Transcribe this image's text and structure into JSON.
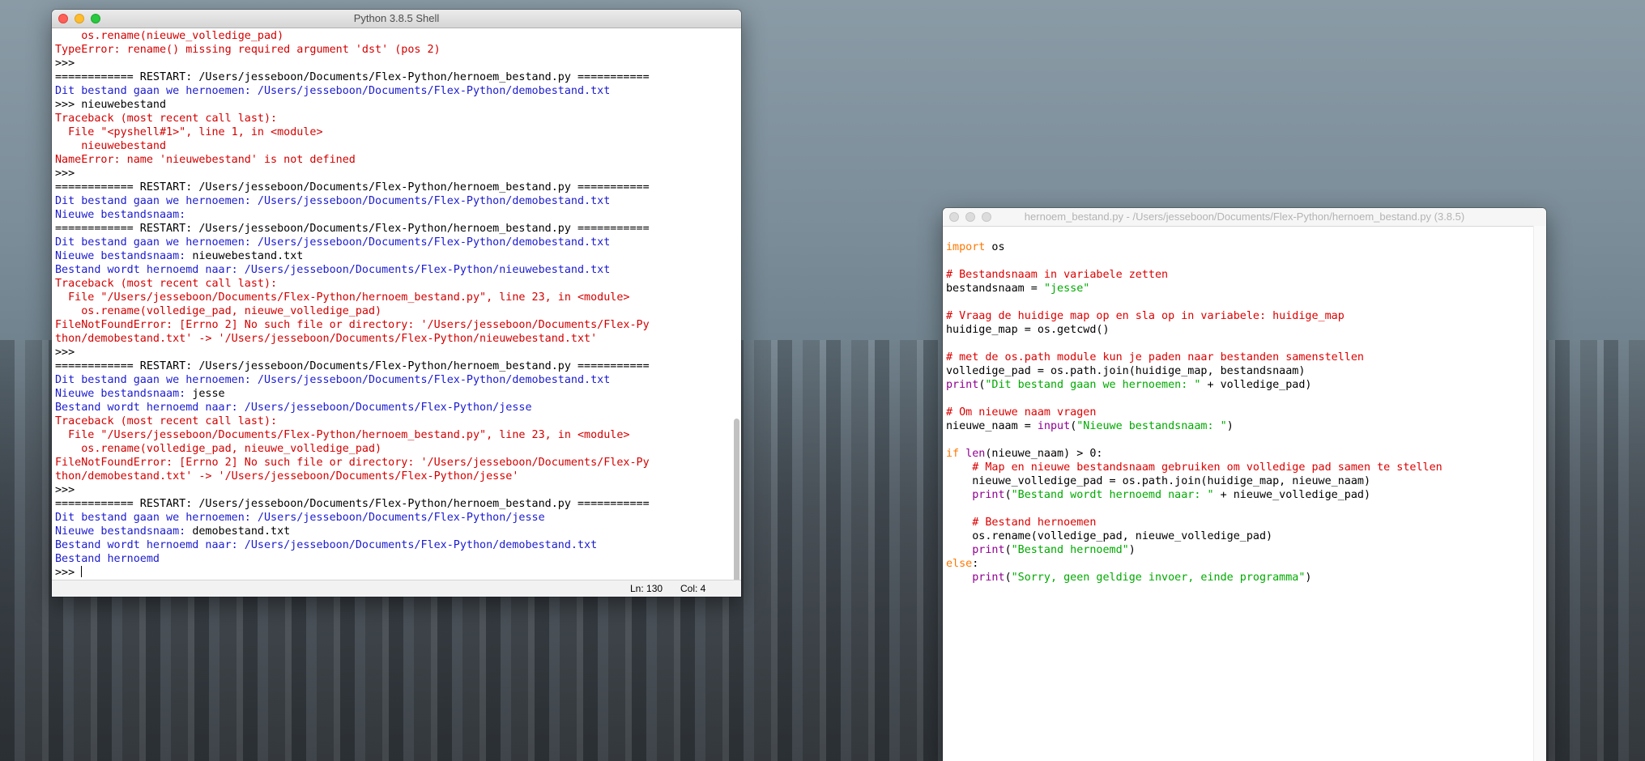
{
  "shell_window": {
    "title": "Python 3.8.5 Shell",
    "lines": [
      {
        "t": "    os.rename(nieuwe_volledige_pad)",
        "c": "err"
      },
      {
        "t": "TypeError: rename() missing required argument 'dst' (pos 2)",
        "c": "err"
      },
      {
        "t": ">>> ",
        "c": ""
      },
      {
        "t": "============ RESTART: /Users/jesseboon/Documents/Flex-Python/hernoem_bestand.py ===========",
        "c": ""
      },
      {
        "t": "Dit bestand gaan we hernoemen: /Users/jesseboon/Documents/Flex-Python/demobestand.txt",
        "c": "out"
      },
      {
        "t": ">>> nieuwebestand",
        "c": ""
      },
      {
        "t": "Traceback (most recent call last):",
        "c": "err"
      },
      {
        "t": "  File \"<pyshell#1>\", line 1, in <module>",
        "c": "err"
      },
      {
        "t": "    nieuwebestand",
        "c": "err"
      },
      {
        "t": "NameError: name 'nieuwebestand' is not defined",
        "c": "err"
      },
      {
        "t": ">>> ",
        "c": ""
      },
      {
        "t": "============ RESTART: /Users/jesseboon/Documents/Flex-Python/hernoem_bestand.py ===========",
        "c": ""
      },
      {
        "t": "Dit bestand gaan we hernoemen: /Users/jesseboon/Documents/Flex-Python/demobestand.txt",
        "c": "out"
      },
      {
        "t": "Nieuwe bestandsnaam: ",
        "c": "out"
      },
      {
        "t": "============ RESTART: /Users/jesseboon/Documents/Flex-Python/hernoem_bestand.py ===========",
        "c": ""
      },
      {
        "t": "Dit bestand gaan we hernoemen: /Users/jesseboon/Documents/Flex-Python/demobestand.txt",
        "c": "out"
      },
      {
        "segs": [
          {
            "t": "Nieuwe bestandsnaam: ",
            "c": "out"
          },
          {
            "t": "nieuwebestand.txt",
            "c": ""
          }
        ]
      },
      {
        "t": "Bestand wordt hernoemd naar: /Users/jesseboon/Documents/Flex-Python/nieuwebestand.txt",
        "c": "out"
      },
      {
        "t": "Traceback (most recent call last):",
        "c": "err"
      },
      {
        "t": "  File \"/Users/jesseboon/Documents/Flex-Python/hernoem_bestand.py\", line 23, in <module>",
        "c": "err"
      },
      {
        "t": "    os.rename(volledige_pad, nieuwe_volledige_pad)",
        "c": "err"
      },
      {
        "t": "FileNotFoundError: [Errno 2] No such file or directory: '/Users/jesseboon/Documents/Flex-Py",
        "c": "err"
      },
      {
        "t": "thon/demobestand.txt' -> '/Users/jesseboon/Documents/Flex-Python/nieuwebestand.txt'",
        "c": "err"
      },
      {
        "t": ">>> ",
        "c": ""
      },
      {
        "t": "============ RESTART: /Users/jesseboon/Documents/Flex-Python/hernoem_bestand.py ===========",
        "c": ""
      },
      {
        "t": "Dit bestand gaan we hernoemen: /Users/jesseboon/Documents/Flex-Python/demobestand.txt",
        "c": "out"
      },
      {
        "segs": [
          {
            "t": "Nieuwe bestandsnaam: ",
            "c": "out"
          },
          {
            "t": "jesse",
            "c": ""
          }
        ]
      },
      {
        "t": "Bestand wordt hernoemd naar: /Users/jesseboon/Documents/Flex-Python/jesse",
        "c": "out"
      },
      {
        "t": "Traceback (most recent call last):",
        "c": "err"
      },
      {
        "t": "  File \"/Users/jesseboon/Documents/Flex-Python/hernoem_bestand.py\", line 23, in <module>",
        "c": "err"
      },
      {
        "t": "    os.rename(volledige_pad, nieuwe_volledige_pad)",
        "c": "err"
      },
      {
        "t": "FileNotFoundError: [Errno 2] No such file or directory: '/Users/jesseboon/Documents/Flex-Py",
        "c": "err"
      },
      {
        "t": "thon/demobestand.txt' -> '/Users/jesseboon/Documents/Flex-Python/jesse'",
        "c": "err"
      },
      {
        "t": ">>> ",
        "c": ""
      },
      {
        "t": "============ RESTART: /Users/jesseboon/Documents/Flex-Python/hernoem_bestand.py ===========",
        "c": ""
      },
      {
        "t": "Dit bestand gaan we hernoemen: /Users/jesseboon/Documents/Flex-Python/jesse",
        "c": "out"
      },
      {
        "segs": [
          {
            "t": "Nieuwe bestandsnaam: ",
            "c": "out"
          },
          {
            "t": "demobestand.txt",
            "c": ""
          }
        ]
      },
      {
        "t": "Bestand wordt hernoemd naar: /Users/jesseboon/Documents/Flex-Python/demobestand.txt",
        "c": "out"
      },
      {
        "t": "Bestand hernoemd",
        "c": "out"
      },
      {
        "t": ">>> ",
        "c": "",
        "cursor": true
      }
    ],
    "status": {
      "line": "Ln: 130",
      "col": "Col: 4"
    }
  },
  "editor_window": {
    "title": "hernoem_bestand.py - /Users/jesseboon/Documents/Flex-Python/hernoem_bestand.py (3.8.5)",
    "lines": [
      {
        "segs": [
          {
            "t": "import",
            "c": "kw"
          },
          {
            "t": " os",
            "c": ""
          }
        ]
      },
      {
        "segs": []
      },
      {
        "segs": [
          {
            "t": "# Bestandsnaam in variabele zetten",
            "c": "cm"
          }
        ]
      },
      {
        "segs": [
          {
            "t": "bestandsnaam = ",
            "c": ""
          },
          {
            "t": "\"jesse\"",
            "c": "st"
          }
        ]
      },
      {
        "segs": []
      },
      {
        "segs": [
          {
            "t": "# Vraag de huidige map op en sla op in variabele: huidige_map",
            "c": "cm"
          }
        ]
      },
      {
        "segs": [
          {
            "t": "huidige_map = os.getcwd()",
            "c": ""
          }
        ]
      },
      {
        "segs": []
      },
      {
        "segs": [
          {
            "t": "# met de os.path module kun je paden naar bestanden samenstellen",
            "c": "cm"
          }
        ]
      },
      {
        "segs": [
          {
            "t": "volledige_pad = os.path.join(huidige_map, bestandsnaam)",
            "c": ""
          }
        ]
      },
      {
        "segs": [
          {
            "t": "print",
            "c": "bi"
          },
          {
            "t": "(",
            "c": ""
          },
          {
            "t": "\"Dit bestand gaan we hernoemen: \"",
            "c": "st"
          },
          {
            "t": " + volledige_pad)",
            "c": ""
          }
        ]
      },
      {
        "segs": []
      },
      {
        "segs": [
          {
            "t": "# Om nieuwe naam vragen",
            "c": "cm"
          }
        ]
      },
      {
        "segs": [
          {
            "t": "nieuwe_naam = ",
            "c": ""
          },
          {
            "t": "input",
            "c": "bi"
          },
          {
            "t": "(",
            "c": ""
          },
          {
            "t": "\"Nieuwe bestandsnaam: \"",
            "c": "st"
          },
          {
            "t": ")",
            "c": ""
          }
        ]
      },
      {
        "segs": []
      },
      {
        "segs": [
          {
            "t": "if",
            "c": "kw"
          },
          {
            "t": " ",
            "c": ""
          },
          {
            "t": "len",
            "c": "bi"
          },
          {
            "t": "(nieuwe_naam) > 0:",
            "c": ""
          }
        ]
      },
      {
        "segs": [
          {
            "t": "    ",
            "c": ""
          },
          {
            "t": "# Map en nieuwe bestandsnaam gebruiken om volledige pad samen te stellen",
            "c": "cm"
          }
        ]
      },
      {
        "segs": [
          {
            "t": "    nieuwe_volledige_pad = os.path.join(huidige_map, nieuwe_naam)",
            "c": ""
          }
        ]
      },
      {
        "segs": [
          {
            "t": "    ",
            "c": ""
          },
          {
            "t": "print",
            "c": "bi"
          },
          {
            "t": "(",
            "c": ""
          },
          {
            "t": "\"Bestand wordt hernoemd naar: \"",
            "c": "st"
          },
          {
            "t": " + nieuwe_volledige_pad)",
            "c": ""
          }
        ]
      },
      {
        "segs": []
      },
      {
        "segs": [
          {
            "t": "    ",
            "c": ""
          },
          {
            "t": "# Bestand hernoemen",
            "c": "cm"
          }
        ]
      },
      {
        "segs": [
          {
            "t": "    os.rename(volledige_pad, nieuwe_volledige_pad)",
            "c": ""
          }
        ]
      },
      {
        "segs": [
          {
            "t": "    ",
            "c": ""
          },
          {
            "t": "print",
            "c": "bi"
          },
          {
            "t": "(",
            "c": ""
          },
          {
            "t": "\"Bestand hernoemd\"",
            "c": "st"
          },
          {
            "t": ")",
            "c": ""
          }
        ]
      },
      {
        "segs": [
          {
            "t": "else",
            "c": "kw"
          },
          {
            "t": ":",
            "c": ""
          }
        ]
      },
      {
        "segs": [
          {
            "t": "    ",
            "c": ""
          },
          {
            "t": "print",
            "c": "bi"
          },
          {
            "t": "(",
            "c": ""
          },
          {
            "t": "\"Sorry, geen geldige invoer, einde programma\"",
            "c": "st"
          },
          {
            "t": ")",
            "c": ""
          }
        ]
      }
    ]
  },
  "colors": {
    "output_blue": "#1b1bd0",
    "error_red": "#d40000",
    "keyword_orange": "#ff7700",
    "comment_red": "#dd0000",
    "string_green": "#00aa00",
    "builtin_purple": "#900090"
  }
}
